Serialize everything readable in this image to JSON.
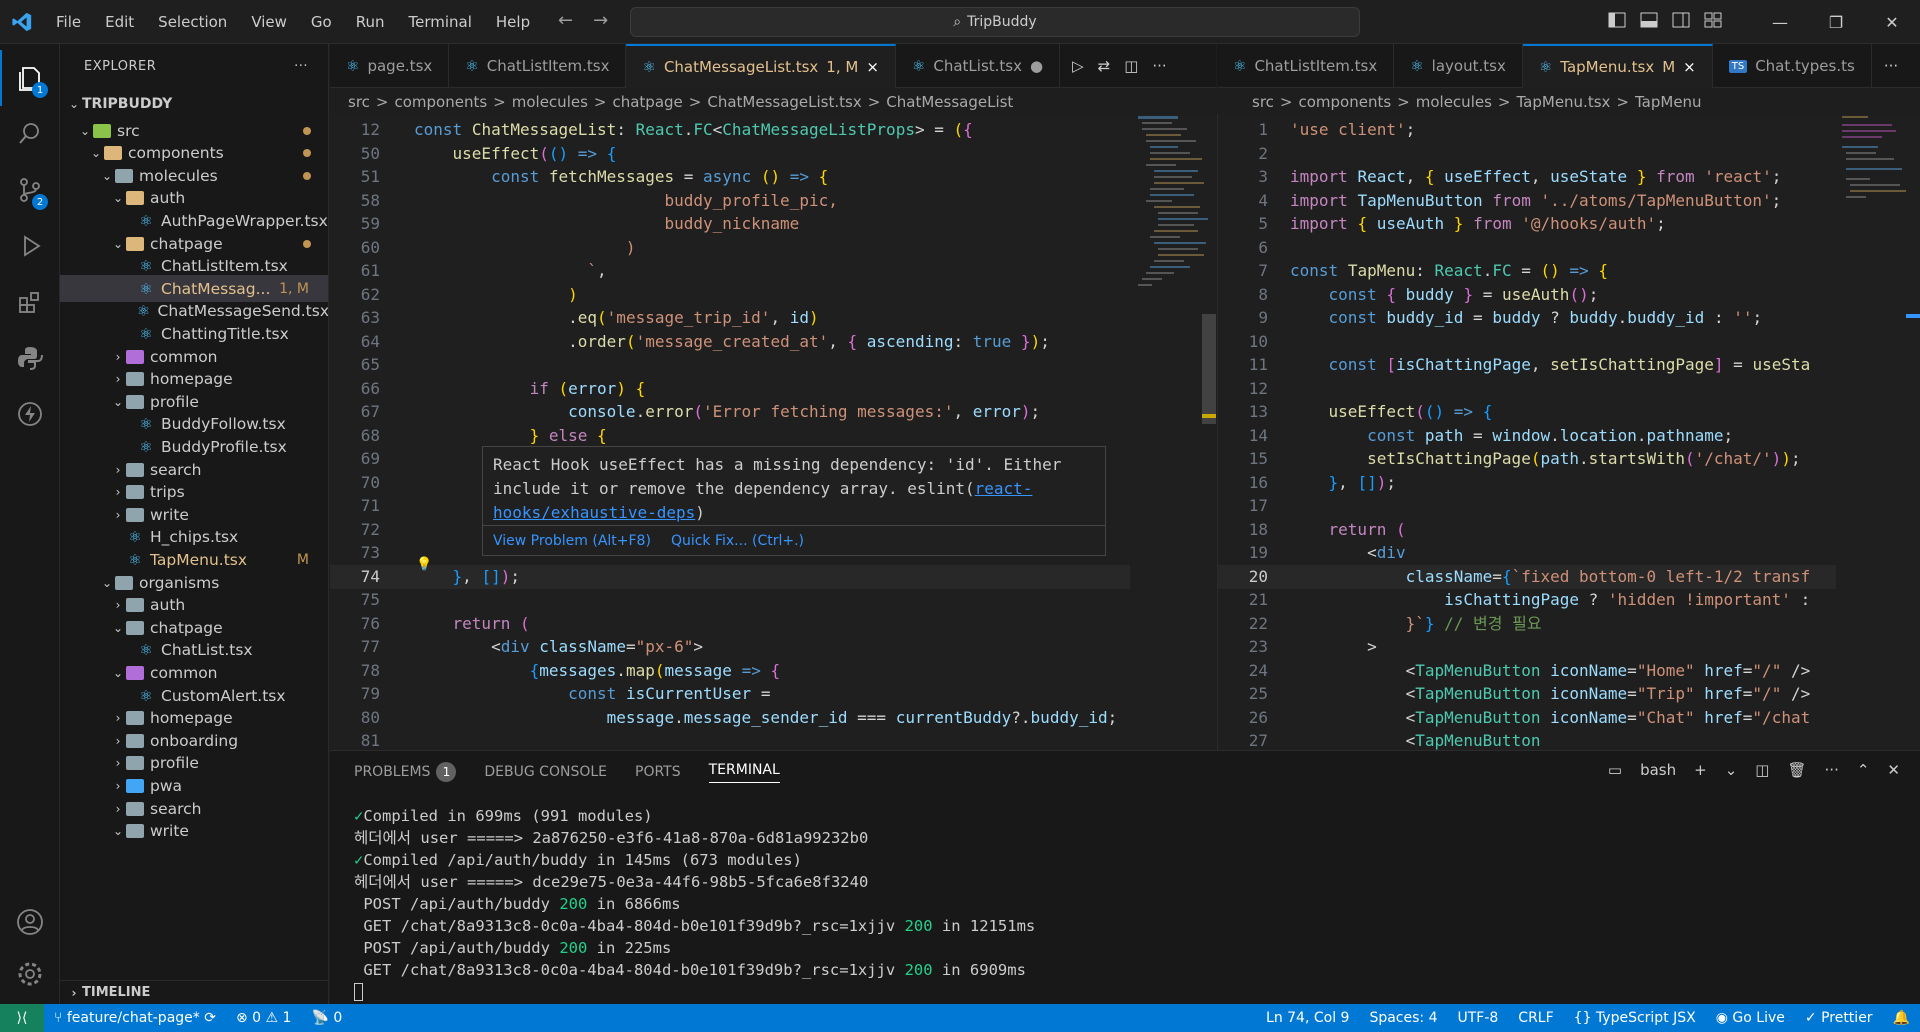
{
  "menu": [
    "File",
    "Edit",
    "Selection",
    "View",
    "Go",
    "Run",
    "Terminal",
    "Help"
  ],
  "search": "TripBuddy",
  "activity": {
    "explorer_badge": "1",
    "scm_badge": "2"
  },
  "sidebar": {
    "title": "EXPLORER",
    "project": "TRIPBUDDY",
    "items": [
      {
        "label": "src",
        "depth": 1,
        "kind": "folder-green",
        "open": true,
        "dot": true
      },
      {
        "label": "components",
        "depth": 2,
        "kind": "folder",
        "open": true,
        "dot": true
      },
      {
        "label": "molecules",
        "depth": 3,
        "kind": "folder-grey",
        "open": true,
        "dot": true
      },
      {
        "label": "auth",
        "depth": 4,
        "kind": "folder",
        "open": true
      },
      {
        "label": "AuthPageWrapper.tsx",
        "depth": 5,
        "kind": "react"
      },
      {
        "label": "chatpage",
        "depth": 4,
        "kind": "folder",
        "open": true,
        "dot": true
      },
      {
        "label": "ChatListItem.tsx",
        "depth": 5,
        "kind": "react"
      },
      {
        "label": "ChatMessag...",
        "depth": 5,
        "kind": "react",
        "selected": true,
        "flag": "1, M"
      },
      {
        "label": "ChatMessageSend.tsx",
        "depth": 5,
        "kind": "react"
      },
      {
        "label": "ChattingTitle.tsx",
        "depth": 5,
        "kind": "react"
      },
      {
        "label": "common",
        "depth": 4,
        "kind": "folder-purple",
        "open": false
      },
      {
        "label": "homepage",
        "depth": 4,
        "kind": "folder-grey",
        "open": false
      },
      {
        "label": "profile",
        "depth": 4,
        "kind": "folder-grey",
        "open": true
      },
      {
        "label": "BuddyFollow.tsx",
        "depth": 5,
        "kind": "react"
      },
      {
        "label": "BuddyProfile.tsx",
        "depth": 5,
        "kind": "react"
      },
      {
        "label": "search",
        "depth": 4,
        "kind": "folder-grey",
        "open": false
      },
      {
        "label": "trips",
        "depth": 4,
        "kind": "folder-grey",
        "open": false
      },
      {
        "label": "write",
        "depth": 4,
        "kind": "folder-grey",
        "open": false
      },
      {
        "label": "H_chips.tsx",
        "depth": 4,
        "kind": "react"
      },
      {
        "label": "TapMenu.tsx",
        "depth": 4,
        "kind": "react",
        "flag": "M",
        "mod": true
      },
      {
        "label": "organisms",
        "depth": 3,
        "kind": "folder-grey",
        "open": true
      },
      {
        "label": "auth",
        "depth": 4,
        "kind": "folder-grey",
        "open": false
      },
      {
        "label": "chatpage",
        "depth": 4,
        "kind": "folder-grey",
        "open": true
      },
      {
        "label": "ChatList.tsx",
        "depth": 5,
        "kind": "react"
      },
      {
        "label": "common",
        "depth": 4,
        "kind": "folder-purple",
        "open": true
      },
      {
        "label": "CustomAlert.tsx",
        "depth": 5,
        "kind": "react"
      },
      {
        "label": "homepage",
        "depth": 4,
        "kind": "folder-grey",
        "open": false
      },
      {
        "label": "onboarding",
        "depth": 4,
        "kind": "folder-grey",
        "open": false
      },
      {
        "label": "profile",
        "depth": 4,
        "kind": "folder-grey",
        "open": false
      },
      {
        "label": "pwa",
        "depth": 4,
        "kind": "folder-blue",
        "open": false
      },
      {
        "label": "search",
        "depth": 4,
        "kind": "folder-grey",
        "open": false
      },
      {
        "label": "write",
        "depth": 4,
        "kind": "folder-grey",
        "open": true
      }
    ],
    "timeline": "TIMELINE"
  },
  "left_tabs": [
    {
      "label": "page.tsx",
      "icon": "react"
    },
    {
      "label": "ChatListItem.tsx",
      "icon": "react"
    },
    {
      "label": "ChatMessageList.tsx",
      "suffix": "1, M",
      "icon": "react",
      "active": true,
      "close": "×"
    },
    {
      "label": "ChatList.tsx",
      "icon": "react",
      "dirty": true
    }
  ],
  "right_tabs": [
    {
      "label": "ChatListItem.tsx",
      "icon": "react"
    },
    {
      "label": "layout.tsx",
      "icon": "react"
    },
    {
      "label": "TapMenu.tsx",
      "suffix": "M",
      "icon": "react",
      "active": true,
      "close": "×"
    },
    {
      "label": "Chat.types.ts",
      "icon": "ts",
      "icon_text": "TS"
    }
  ],
  "left_crumbs": [
    "src",
    ">",
    "components",
    ">",
    "molecules",
    ">",
    "chatpage",
    ">",
    "ChatMessageList.tsx",
    ">",
    "ChatMessageList"
  ],
  "right_crumbs": [
    "src",
    ">",
    "components",
    ">",
    "molecules",
    ">",
    "TapMenu.tsx",
    ">",
    "TapMenu"
  ],
  "left_code": [
    {
      "n": "12",
      "html": "<span class='kw'>const</span> <span class='fn'>ChatMessageList</span><span class='pl'>: </span><span class='ty'>React</span><span class='pl'>.</span><span class='ty'>FC</span><span class='pl'>&lt;</span><span class='ty'>ChatMessageListProps</span><span class='pl'>&gt; = </span><span class='br1'>(</span><span class='br2'>{</span>"
    },
    {
      "n": "50",
      "html": "    <span class='fn'>useEffect</span><span class='br2'>(</span><span class='br3'>()</span> <span class='kw'>=&gt;</span> <span class='br3'>{</span>"
    },
    {
      "n": "51",
      "html": "        <span class='kw'>const</span> <span class='fn'>fetchMessages</span> <span class='pl'>=</span> <span class='kw'>async</span> <span class='br1'>()</span> <span class='kw'>=&gt;</span> <span class='br1'>{</span>"
    },
    {
      "n": "58",
      "html": "                          <span class='str'>buddy_profile_pic,</span>"
    },
    {
      "n": "59",
      "html": "                          <span class='str'>buddy_nickname</span>"
    },
    {
      "n": "60",
      "html": "                      <span class='str'>)</span>"
    },
    {
      "n": "61",
      "html": "                  <span class='str'>`</span><span class='pl'>,</span>"
    },
    {
      "n": "62",
      "html": "                <span class='br1'>)</span>"
    },
    {
      "n": "63",
      "html": "                <span class='pl'>.</span><span class='fn'>eq</span><span class='br1'>(</span><span class='str'>'message_trip_id'</span><span class='pl'>, </span><span class='var'>id</span><span class='br1'>)</span>"
    },
    {
      "n": "64",
      "html": "                <span class='pl'>.</span><span class='fn'>order</span><span class='br1'>(</span><span class='str'>'message_created_at'</span><span class='pl'>, </span><span class='br2'>{</span> <span class='var'>ascending</span><span class='pl'>: </span><span class='kw'>true</span> <span class='br2'>}</span><span class='br1'>)</span><span class='pl'>;</span>"
    },
    {
      "n": "65",
      "html": ""
    },
    {
      "n": "66",
      "html": "            <span class='kw2'>if</span> <span class='br1'>(</span><span class='var'>error</span><span class='br1'>)</span> <span class='br1'>{</span>"
    },
    {
      "n": "67",
      "html": "                <span class='var'>console</span><span class='pl'>.</span><span class='fn'>error</span><span class='br2'>(</span><span class='str'>'Error fetching messages:'</span><span class='pl'>, </span><span class='var'>error</span><span class='br2'>)</span><span class='pl'>;</span>"
    },
    {
      "n": "68",
      "html": "            <span class='br1'>}</span> <span class='kw2'>else</span> <span class='br1'>{</span>"
    },
    {
      "n": "69",
      "html": ""
    },
    {
      "n": "70",
      "html": ""
    },
    {
      "n": "71",
      "html": ""
    },
    {
      "n": "72",
      "html": ""
    },
    {
      "n": "73",
      "html": ""
    },
    {
      "n": "74",
      "html": "    <span class='br3'>}</span><span class='pl'>, </span><span class='br3'>[]</span><span class='br2'>)</span><span class='pl'>;</span>",
      "current": true
    },
    {
      "n": "75",
      "html": ""
    },
    {
      "n": "76",
      "html": "    <span class='kw2'>return</span> <span class='br2'>(</span>"
    },
    {
      "n": "77",
      "html": "        <span class='pl'>&lt;</span><span class='kw'>div</span> <span class='attr'>className</span><span class='pl'>=</span><span class='str'>\"px-6\"</span><span class='pl'>&gt;</span>"
    },
    {
      "n": "78",
      "html": "            <span class='br3'>{</span><span class='var'>messages</span><span class='pl'>.</span><span class='fn'>map</span><span class='br1'>(</span><span class='var'>message</span> <span class='kw'>=&gt;</span> <span class='br2'>{</span>"
    },
    {
      "n": "79",
      "html": "                <span class='kw'>const</span> <span class='var'>isCurrentUser</span> <span class='pl'>=</span>"
    },
    {
      "n": "80",
      "html": "                    <span class='var'>message</span><span class='pl'>.</span><span class='var'>message_sender_id</span> <span class='pl'>===</span> <span class='var'>currentBuddy</span><span class='pl'>?.</span><span class='var'>buddy_id</span><span class='pl'>;</span>"
    },
    {
      "n": "81",
      "html": ""
    }
  ],
  "right_code": [
    {
      "n": "1",
      "html": "<span class='str'>'use client'</span><span class='pl'>;</span>"
    },
    {
      "n": "2",
      "html": ""
    },
    {
      "n": "3",
      "html": "<span class='kw2'>import</span> <span class='var'>React</span><span class='pl'>, </span><span class='br1'>{</span> <span class='var'>useEffect</span><span class='pl'>, </span><span class='var'>useState</span> <span class='br1'>}</span> <span class='kw2'>from</span> <span class='str'>'react'</span><span class='pl'>;</span>"
    },
    {
      "n": "4",
      "html": "<span class='kw2'>import</span> <span class='var'>TapMenuButton</span> <span class='kw2'>from</span> <span class='str'>'../atoms/TapMenuButton'</span><span class='pl'>;</span>"
    },
    {
      "n": "5",
      "html": "<span class='kw2'>import</span> <span class='br1'>{</span> <span class='var'>useAuth</span> <span class='br1'>}</span> <span class='kw2'>from</span> <span class='str'>'@/hooks/auth'</span><span class='pl'>;</span>"
    },
    {
      "n": "6",
      "html": ""
    },
    {
      "n": "7",
      "html": "<span class='kw'>const</span> <span class='fn'>TapMenu</span><span class='pl'>: </span><span class='ty'>React</span><span class='pl'>.</span><span class='ty'>FC</span> <span class='pl'>=</span> <span class='br1'>()</span> <span class='kw'>=&gt;</span> <span class='br1'>{</span>"
    },
    {
      "n": "8",
      "html": "    <span class='kw'>const</span> <span class='br2'>{</span> <span class='var'>buddy</span> <span class='br2'>}</span> <span class='pl'>=</span> <span class='fn'>useAuth</span><span class='br2'>()</span><span class='pl'>;</span>"
    },
    {
      "n": "9",
      "html": "    <span class='kw'>const</span> <span class='var'>buddy_id</span> <span class='pl'>=</span> <span class='var'>buddy</span> <span class='pl'>?</span> <span class='var'>buddy</span><span class='pl'>.</span><span class='var'>buddy_id</span> <span class='pl'>:</span> <span class='str'>''</span><span class='pl'>;</span>"
    },
    {
      "n": "10",
      "html": ""
    },
    {
      "n": "11",
      "html": "    <span class='kw'>const</span> <span class='br2'>[</span><span class='var'>isChattingPage</span><span class='pl'>, </span><span class='fn'>setIsChattingPage</span><span class='br2'>]</span> <span class='pl'>=</span> <span class='fn'>useSta</span>"
    },
    {
      "n": "12",
      "html": ""
    },
    {
      "n": "13",
      "html": "    <span class='fn'>useEffect</span><span class='br2'>(</span><span class='br3'>()</span> <span class='kw'>=&gt;</span> <span class='br3'>{</span>"
    },
    {
      "n": "14",
      "html": "        <span class='kw'>const</span> <span class='var'>path</span> <span class='pl'>=</span> <span class='var'>window</span><span class='pl'>.</span><span class='var'>location</span><span class='pl'>.</span><span class='var'>pathname</span><span class='pl'>;</span>"
    },
    {
      "n": "15",
      "html": "        <span class='fn'>setIsChattingPage</span><span class='br1'>(</span><span class='var'>path</span><span class='pl'>.</span><span class='fn'>startsWith</span><span class='br2'>(</span><span class='str'>'/chat/'</span><span class='br2'>)</span><span class='br1'>)</span><span class='pl'>;</span>"
    },
    {
      "n": "16",
      "html": "    <span class='br3'>}</span><span class='pl'>, </span><span class='br3'>[]</span><span class='br2'>)</span><span class='pl'>;</span>"
    },
    {
      "n": "17",
      "html": ""
    },
    {
      "n": "18",
      "html": "    <span class='kw2'>return</span> <span class='br2'>(</span>"
    },
    {
      "n": "19",
      "html": "        <span class='pl'>&lt;</span><span class='kw'>div</span>"
    },
    {
      "n": "20",
      "html": "            <span class='attr'>className</span><span class='pl'>=</span><span class='br3'>{</span><span class='str'>`fixed bottom-0 left-1/2 transf</span>",
      "current": true
    },
    {
      "n": "21",
      "html": "                <span class='var'>isChattingPage</span> <span class='pl'>?</span> <span class='str'>'hidden !important'</span> <span class='pl'>:</span>"
    },
    {
      "n": "22",
      "html": "            <span class='str'>}`</span><span class='br3'>}</span> <span class='cm'>// 변경 필요</span>"
    },
    {
      "n": "23",
      "html": "        <span class='pl'>&gt;</span>"
    },
    {
      "n": "24",
      "html": "            <span class='pl'>&lt;</span><span class='tag'>TapMenuButton</span> <span class='attr'>iconName</span><span class='pl'>=</span><span class='str'>\"Home\"</span> <span class='attr'>href</span><span class='pl'>=</span><span class='str'>\"/\"</span> <span class='pl'>/&gt;</span>"
    },
    {
      "n": "25",
      "html": "            <span class='pl'>&lt;</span><span class='tag'>TapMenuButton</span> <span class='attr'>iconName</span><span class='pl'>=</span><span class='str'>\"Trip\"</span> <span class='attr'>href</span><span class='pl'>=</span><span class='str'>\"/\"</span> <span class='pl'>/&gt;</span>"
    },
    {
      "n": "26",
      "html": "            <span class='pl'>&lt;</span><span class='tag'>TapMenuButton</span> <span class='attr'>iconName</span><span class='pl'>=</span><span class='str'>\"Chat\"</span> <span class='attr'>href</span><span class='pl'>=</span><span class='str'>\"/chat</span>"
    },
    {
      "n": "27",
      "html": "            <span class='pl'>&lt;</span><span class='tag'>TapMenuButton</span>"
    }
  ],
  "hover": {
    "message": "React Hook useEffect has a missing dependency: 'id'. Either include it or remove the dependency array. eslint(",
    "link": "react-hooks/exhaustive-deps",
    "tail": ")",
    "view_problem": "View Problem (Alt+F8)",
    "quick_fix": "Quick Fix... (Ctrl+.)"
  },
  "panel": {
    "tabs": [
      "PROBLEMS",
      "DEBUG CONSOLE",
      "PORTS",
      "TERMINAL"
    ],
    "problems_count": "1",
    "active_tab": "TERMINAL",
    "shell": "bash",
    "terminal": [
      {
        "check": "✓",
        "text": "Compiled in 699ms (991 modules)"
      },
      {
        "text": "헤더에서 user =====> 2a876250-e3f6-41a8-870a-6d81a99232b0"
      },
      {
        "check": "✓",
        "text": "Compiled /api/auth/buddy in 145ms (673 modules)"
      },
      {
        "text": "헤더에서 user =====> dce29e75-0e3a-44f6-98b5-5fca6e8f3240"
      },
      {
        "pre": " POST /api/auth/buddy ",
        "code": "200",
        "post": " in 6866ms"
      },
      {
        "pre": " GET /chat/8a9313c8-0c0a-4ba4-804d-b0e101f39d9b?_rsc=1xjjv ",
        "code": "200",
        "post": " in 12151ms"
      },
      {
        "pre": " POST /api/auth/buddy ",
        "code": "200",
        "post": " in 225ms"
      },
      {
        "pre": " GET /chat/8a9313c8-0c0a-4ba4-804d-b0e101f39d9b?_rsc=1xjjv ",
        "code": "200",
        "post": " in 6909ms"
      }
    ]
  },
  "status": {
    "branch": "feature/chat-page*",
    "errors": "0",
    "warnings": "1",
    "ports": "0",
    "position": "Ln 74, Col 9",
    "spaces": "Spaces: 4",
    "encoding": "UTF-8",
    "eol": "CRLF",
    "language": "TypeScript JSX",
    "golive": "Go Live",
    "prettier": "Prettier"
  },
  "colors": {
    "accent": "#0078d4",
    "statusbar": "#0078d4",
    "remote": "#16825d",
    "modified": "#c09553"
  }
}
